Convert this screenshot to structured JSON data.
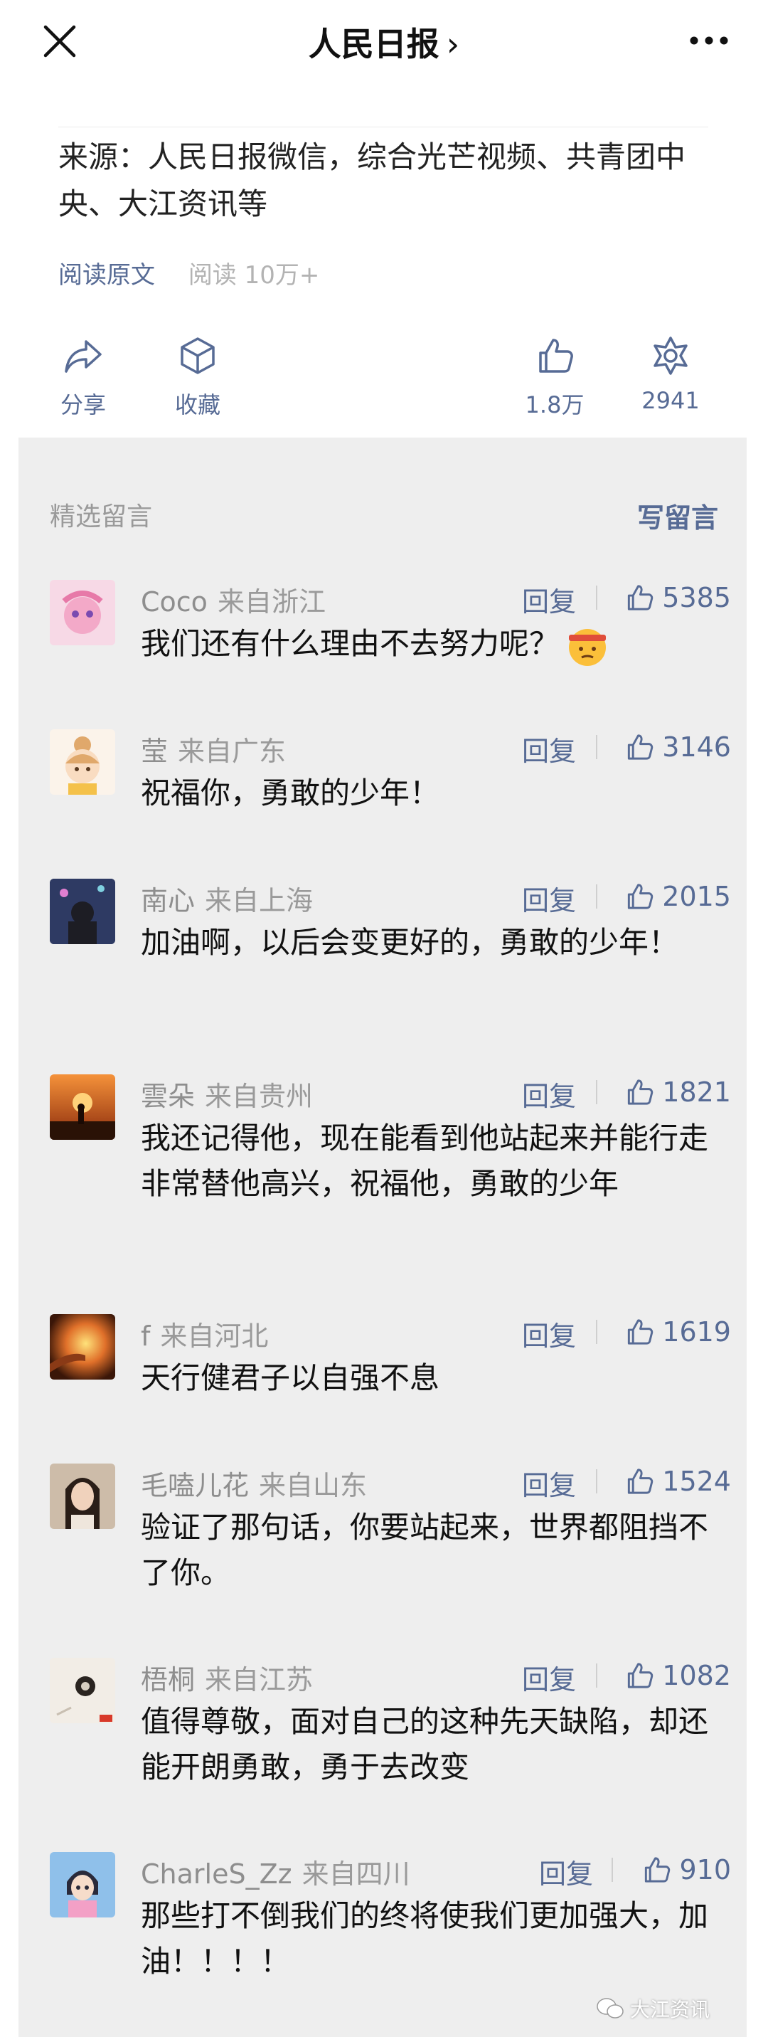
{
  "header": {
    "title": "人民日报",
    "chevron": "›",
    "close_icon": "close-icon",
    "more_icon": "more-icon"
  },
  "article": {
    "source": "来源：人民日报微信，综合光芒视频、共青团中央、大江资讯等",
    "read_original": "阅读原文",
    "read_count": "阅读 10万+"
  },
  "actions": {
    "share_label": "分享",
    "favorite_label": "收藏",
    "likes_count": "1.8万",
    "wow_count": "2941"
  },
  "comments_section": {
    "title": "精选留言",
    "write_label": "写留言",
    "reply_label": "回复",
    "items": [
      {
        "name": "Coco",
        "location": "来自浙江",
        "likes": "5385",
        "text": "我们还有什么理由不去努力呢？",
        "avatar_color": "#f3a9c8"
      },
      {
        "name": "莹",
        "location": "来自广东",
        "likes": "3146",
        "text": "祝福你，勇敢的少年！",
        "avatar_color": "#f4dcc4"
      },
      {
        "name": "南心",
        "location": "来自上海",
        "likes": "2015",
        "text": "加油啊，以后会变更好的，勇敢的少年！",
        "avatar_color": "#3d4a70"
      },
      {
        "name": "雲朵",
        "location": "来自贵州",
        "likes": "1821",
        "text": "我还记得他，现在能看到他站起来并能行走非常替他高兴，祝福他，勇敢的少年",
        "avatar_color": "#d9591c"
      },
      {
        "name": "f",
        "location": "来自河北",
        "likes": "1619",
        "text": "天行健君子以自强不息",
        "avatar_color": "#c0521f"
      },
      {
        "name": "毛嗑儿花",
        "location": "来自山东",
        "likes": "1524",
        "text": "验证了那句话，你要站起来，世界都阻挡不了你。",
        "avatar_color": "#6b5a4c"
      },
      {
        "name": "梧桐",
        "location": "来自江苏",
        "likes": "1082",
        "text": "值得尊敬，面对自己的这种先天缺陷，却还能开朗勇敢，勇于去改变",
        "avatar_color": "#ebe6df"
      },
      {
        "name": "CharleS_Zz",
        "location": "来自四川",
        "likes": "910",
        "text": "那些打不倒我们的终将使我们更加强大，加油！！！！",
        "avatar_color": "#7fb0e0"
      }
    ]
  },
  "watermark": "大江资讯"
}
